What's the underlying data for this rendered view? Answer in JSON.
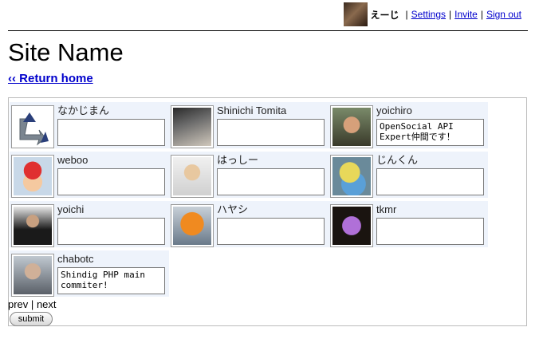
{
  "header": {
    "username": "えーじ",
    "links": {
      "settings": "Settings",
      "invite": "Invite",
      "sign_out": "Sign out"
    },
    "separator": "|"
  },
  "page": {
    "site_name": "Site Name",
    "return_home": "‹‹ Return home"
  },
  "friends": [
    {
      "name": "なかじまん",
      "message": "",
      "avatar": "reverse-arrow-logo"
    },
    {
      "name": "Shinichi Tomita",
      "message": "",
      "avatar": "person-photo"
    },
    {
      "name": "yoichiro",
      "message": "OpenSocial API Expert仲間です！",
      "avatar": "person-photo"
    },
    {
      "name": "weboo",
      "message": "",
      "avatar": "mario-photo"
    },
    {
      "name": "はっしー",
      "message": "",
      "avatar": "cartoon-face"
    },
    {
      "name": "じんくん",
      "message": "",
      "avatar": "bird-photo"
    },
    {
      "name": "yoichi",
      "message": "",
      "avatar": "person-photo"
    },
    {
      "name": "ハヤシ",
      "message": "",
      "avatar": "person-photo"
    },
    {
      "name": "tkmr",
      "message": "",
      "avatar": "person-photo"
    },
    {
      "name": "chabotc",
      "message": "Shindig PHP main commiter!",
      "avatar": "person-photo"
    }
  ],
  "pager": {
    "prev": "prev",
    "separator": "|",
    "next": "next"
  },
  "form": {
    "submit_label": "submit"
  }
}
